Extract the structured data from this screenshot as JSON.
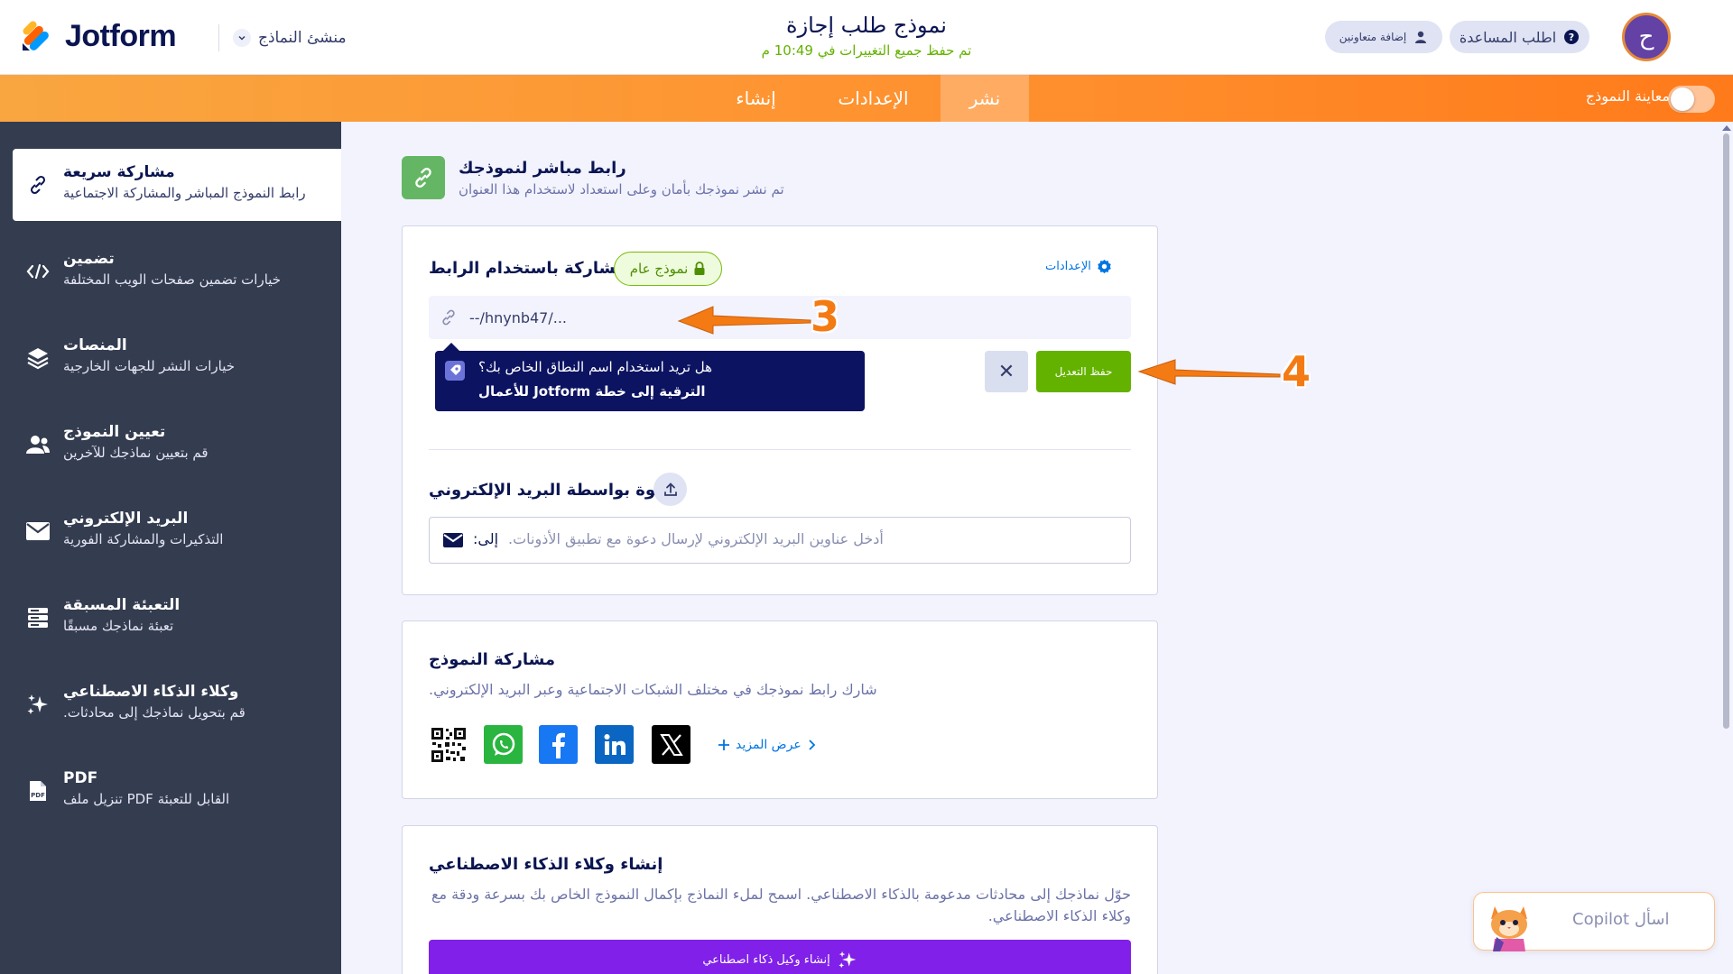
{
  "header": {
    "logo_text": "Jotform",
    "builder_menu": "منشئ النماذج",
    "form_title": "نموذج طلب إجازة",
    "save_status": "تم حفظ جميع التغييرات في 10:49 م",
    "help_button": "اطلب المساعدة",
    "collab_button": "إضافة متعاونين",
    "avatar_letter": "ح"
  },
  "tabs": {
    "publish": "نشر",
    "settings": "الإعدادات",
    "build": "إنشاء",
    "preview_label": "معاينة النموذج",
    "preview_on": false
  },
  "sidebar": {
    "items": [
      {
        "title": "مشاركة سريعة",
        "desc": "رابط النموذج المباشر والمشاركة الاجتماعية",
        "icon": "link-icon",
        "active": true
      },
      {
        "title": "تضمين",
        "desc": "خيارات تضمين صفحات الويب المختلفة",
        "icon": "code-icon"
      },
      {
        "title": "المنصات",
        "desc": "خيارات النشر للجهات الخارجية",
        "icon": "layers-icon"
      },
      {
        "title": "تعيين النموذج",
        "desc": "قم بتعيين نماذجك للآخرين",
        "icon": "users-icon"
      },
      {
        "title": "البريد الإلكتروني",
        "desc": "التذكيرات والمشاركة الفورية",
        "icon": "envelope-icon"
      },
      {
        "title": "التعبئة المسبقة",
        "desc": "تعبئة نماذجك مسبقًا",
        "icon": "prefill-icon"
      },
      {
        "title": "وكلاء الذكاء الاصطناعي",
        "desc": "قم بتحويل نماذجك إلى محادثات.",
        "icon": "sparkle-icon"
      },
      {
        "title": "PDF",
        "desc": "القابل للتعبئة PDF تنزيل ملف",
        "icon": "pdf-icon"
      }
    ]
  },
  "direct": {
    "title": "رابط مباشر لنموذجك",
    "subtitle": "تم نشر نموذجك بأمان وعلى استعداد لاستخدام هذا العنوان"
  },
  "share": {
    "title": "المشاركة باستخدام الرابط",
    "public_badge": "نموذج عام",
    "settings_link": "الإعدادات",
    "url_value": "--/hnynb47/...",
    "tooltip_line1": "هل تريد استخدام اسم النطاق الخاص بك؟",
    "tooltip_line2": "الترقية إلى خطة Jotform للأعمال",
    "save_button": "حفظ التعديل",
    "cancel_symbol": "✕"
  },
  "invite": {
    "title": "دعوة بواسطة البريد الإلكتروني",
    "to_label": "إلى:",
    "placeholder": "أدخل عناوين البريد الإلكتروني لإرسال دعوة مع تطبيق الأذونات."
  },
  "social": {
    "title": "مشاركة النموذج",
    "desc": "شارك رابط نموذجك في مختلف الشبكات الاجتماعية وعبر البريد الإلكتروني.",
    "show_more": "عرض المزيد"
  },
  "ai": {
    "title": "إنشاء وكلاء الذكاء الاصطناعي",
    "desc": "حوّل نماذجك إلى محادثات مدعومة بالذكاء الاصطناعي. اسمح لملء النماذج بإكمال النموذج الخاص بك بسرعة ودقة مع وكلاء الذكاء الاصطناعي.",
    "button": "إنشاء وكيل ذكاء اصطناعي"
  },
  "copilot": {
    "label": "اسأل Copilot"
  },
  "annotations": {
    "three": "3",
    "four": "4"
  },
  "colors": {
    "brand_orange": "#ff8f2d",
    "sidebar_bg": "#343c50",
    "save_green": "#64b200",
    "ai_purple": "#8020e8",
    "annotation_orange": "#f47a14"
  }
}
